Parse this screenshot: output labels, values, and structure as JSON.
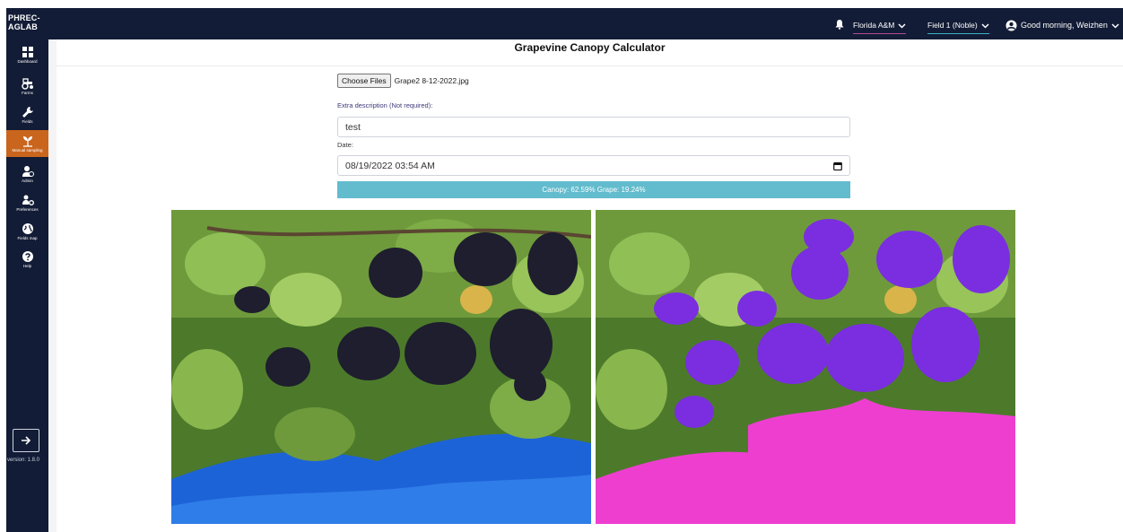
{
  "sidebar": {
    "brand_line1": "PHREC-",
    "brand_line2": "AGLAB",
    "items": [
      {
        "label": "Dashboard",
        "icon": "dashboard-icon",
        "active": false
      },
      {
        "label": "Farms",
        "icon": "tractor-icon",
        "active": false
      },
      {
        "label": "Fields",
        "icon": "wrench-icon",
        "active": false
      },
      {
        "label": "Manual sampling",
        "icon": "plant-icon",
        "active": true
      },
      {
        "label": "Admin",
        "icon": "admin-user-icon",
        "active": false
      },
      {
        "label": "Preferences",
        "icon": "users-cog-icon",
        "active": false
      },
      {
        "label": "Fields map",
        "icon": "globe-icon",
        "active": false
      },
      {
        "label": "Help",
        "icon": "help-icon",
        "active": false
      }
    ],
    "version": "version: 1.8.0"
  },
  "topbar": {
    "farm": "Florida A&M",
    "field": "Field 1 (Noble)",
    "greeting": "Good morning, Weizhen"
  },
  "page": {
    "title": "Grapevine Canopy Calculator",
    "choose_files_label": "Choose Files",
    "file_name": "Grape2 8-12-2022.jpg",
    "extra_description_label": "Extra description (Not required):",
    "extra_description_value": "test",
    "date_label": "Date:",
    "date_value": "08/19/2022 03:54 AM",
    "result": "Canopy: 62.59% Grape: 19.24%"
  },
  "colors": {
    "sidebar_bg": "#121c36",
    "active_item": "#c9651d",
    "result_bar": "#62bccd",
    "canopy_mask": "#7a2ee0",
    "grape_mask": "#ee3ed0"
  }
}
